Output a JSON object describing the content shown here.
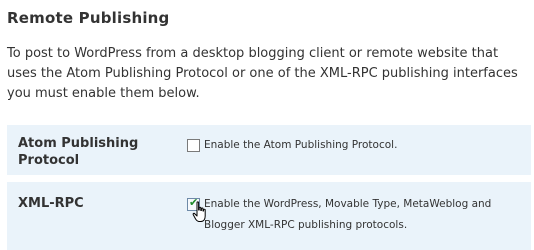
{
  "section": {
    "title": "Remote Publishing",
    "description": "To post to WordPress from a desktop blogging client or remote website that uses the Atom Publishing Protocol or one of the XML-RPC publishing interfaces you must enable them below."
  },
  "settings": [
    {
      "label": "Atom Publishing Protocol",
      "option_label": "Enable the Atom Publishing Protocol.",
      "checked": false
    },
    {
      "label": "XML-RPC",
      "option_label": "Enable the WordPress, Movable Type, MetaWeblog and Blogger XML-RPC publishing protocols.",
      "checked": true
    }
  ],
  "icons": {
    "checkmark": "checkmark-icon",
    "cursor": "hand-pointer-icon"
  },
  "colors": {
    "row_background": "#eaf3fa",
    "text": "#333333",
    "checkmark": "#1e8a2a"
  }
}
